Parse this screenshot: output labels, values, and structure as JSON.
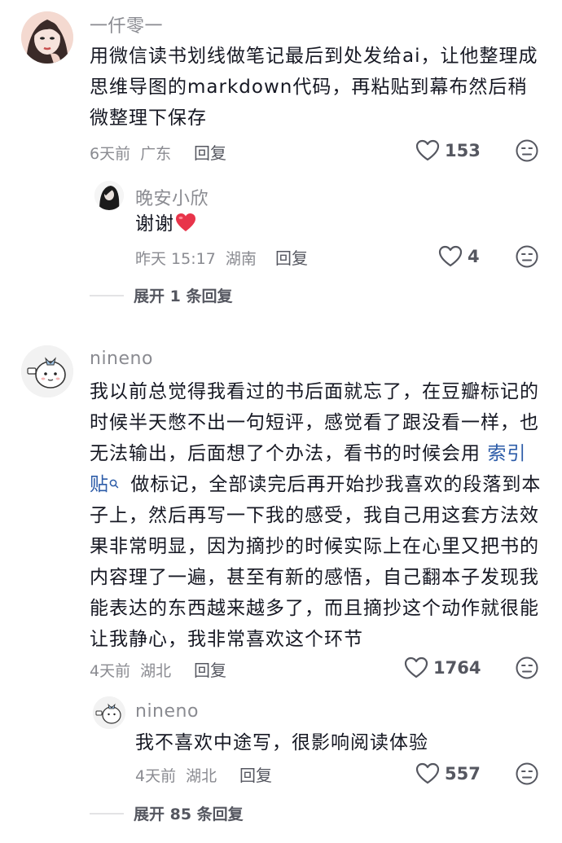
{
  "comments": [
    {
      "username": "一仟零一",
      "text": "用微信读书划线做笔记最后到处发给ai，让他整理成思维导图的markdown代码，再粘贴到幕布然后稍微整理下保存",
      "lines": [
        "用微信读书划线做笔记最后到处发给ai，让他整理成",
        "思维导图的markdown代码，再粘贴到幕布然后稍",
        "微整理下保存"
      ],
      "time": "6天前",
      "location": "广东",
      "reply_label": "回复",
      "likes": "153",
      "replies": [
        {
          "username": "晚安小欣",
          "text": "谢谢",
          "time": "昨天 15:17",
          "location": "湖南",
          "reply_label": "回复",
          "likes": "4"
        }
      ],
      "expand_label": "展开 1 条回复"
    },
    {
      "username": "nineno",
      "lines": [
        "我以前总觉得我看过的书后面就忘了，在豆瓣标记的",
        "时候半天憋不出一句短评，感觉看了跟没看一样，也",
        "无法输出，后面想了个办法，看书的时候会用",
        "做标记，全部读完后再开始抄我喜欢的段落到本",
        "子上，然后再写一下我的感受，我自己用这套方法效",
        "果非常明显，因为摘抄的时候实际上在心里又把书的",
        "内容理了一遍，甚至有新的感悟，自己翻本子发现我",
        "能表达的东西越来越多了，而且摘抄这个动作就很能",
        "让我静心，我非常喜欢这个环节"
      ],
      "link_part1": "索引",
      "link_part2": "贴",
      "time": "4天前",
      "location": "湖北",
      "reply_label": "回复",
      "likes": "1764",
      "replies": [
        {
          "username": "nineno",
          "text": "我不喜欢中途写，很影响阅读体验",
          "time": "4天前",
          "location": "湖北",
          "reply_label": "回复",
          "likes": "557"
        }
      ],
      "expand_label": "展开 85 条回复"
    }
  ]
}
